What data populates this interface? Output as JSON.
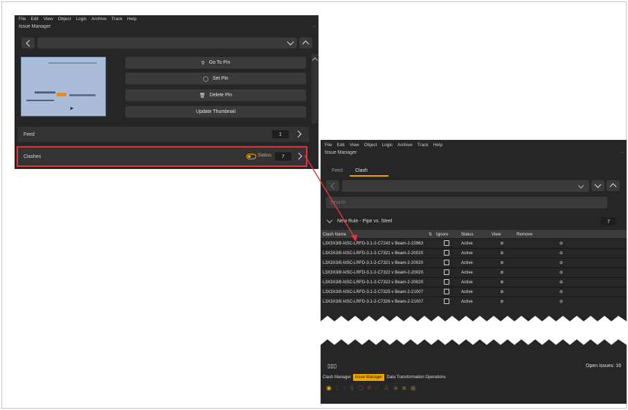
{
  "menu": [
    {
      "label": "File"
    },
    {
      "label": "Edit"
    },
    {
      "label": "View"
    },
    {
      "label": "Object"
    },
    {
      "label": "Logic"
    },
    {
      "label": "Archive"
    },
    {
      "label": "Track"
    },
    {
      "label": "Help"
    }
  ],
  "left_panel": {
    "window_title": "Issue Manager",
    "buttons": {
      "go_to_pin": "Go To Pin",
      "set_pin": "Set Pin",
      "delete_pin": "Delete Pin",
      "update_thumbnail": "Update Thumbnail"
    },
    "feed": {
      "label": "Feed",
      "count": "1"
    },
    "clashes": {
      "label": "Clashes",
      "status": "Status",
      "count": "7"
    }
  },
  "right_panel": {
    "window_title": "Issue Manager",
    "tabs": [
      {
        "label": "Feed"
      },
      {
        "label": "Clash"
      }
    ],
    "search_placeholder": "Search",
    "rule": {
      "label": "New Rule - Pipe vs. Steel",
      "count": "7"
    },
    "columns": {
      "name": "Clash Name",
      "ignore": "Ignore",
      "status": "Status",
      "view": "View",
      "remove": "Remove"
    },
    "rows": [
      {
        "name": "L3X3X3/8 AISC-LRFD-3.1-2-C7242 v Beam-2-22963",
        "status": "Active"
      },
      {
        "name": "L3X3X3/8 AISC-LRFD-3.1-2-C7321 v Beam-2-20020",
        "status": "Active"
      },
      {
        "name": "L3X3X3/8 AISC-LRFD-3.1-2-C7321 v Beam-2-20020",
        "status": "Active"
      },
      {
        "name": "L3X3X3/8 AISC-LRFD-3.1-2-C7322 v Beam-2-20020",
        "status": "Active"
      },
      {
        "name": "L3X3X3/8 AISC-LRFD-3.1-2-C7322 v Beam-2-20020",
        "status": "Active"
      },
      {
        "name": "L3X3X3/8 AISC-LRFD-3.1-2-C7325 v Beam-2-21007",
        "status": "Active"
      },
      {
        "name": "L3X3X3/8 AISC-LRFD-3.1-2-C7326 v Beam-2-21007",
        "status": "Active"
      }
    ],
    "open_issues": "Open Issues: 16",
    "bottom_tabs": [
      {
        "label": "Clash Manager"
      },
      {
        "label": "Issue Manager"
      },
      {
        "label": "Data Transformation Operations"
      }
    ]
  },
  "colors": {
    "accent": "#f0a800",
    "highlight": "#e5333a",
    "panel": "#262626"
  },
  "icons": [
    "back-icon",
    "chevron-down-icon",
    "chevron-up-icon",
    "pin-icon",
    "target-icon",
    "trash-icon",
    "toggle-icon",
    "chevron-right-icon",
    "sort-icon",
    "eye-slash-icon",
    "remove-icon",
    "columns-icon"
  ]
}
